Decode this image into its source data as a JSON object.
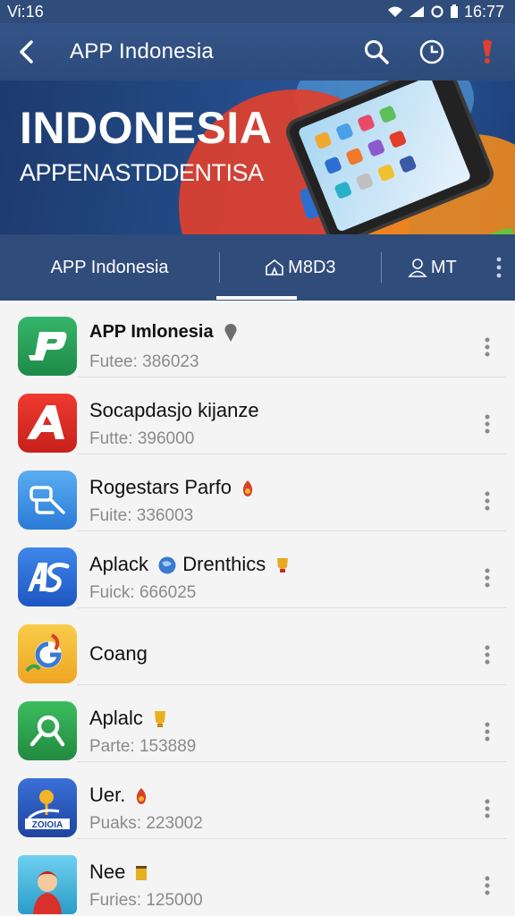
{
  "status_bar": {
    "left_text": "Vi:16",
    "time": "16:77"
  },
  "app_bar": {
    "title": "APP Indonesia"
  },
  "banner": {
    "title": "INDONESIA",
    "subtitle": "APPENASTDDENTISA"
  },
  "tabs": [
    {
      "label": "APP Indonesia",
      "icon": "none"
    },
    {
      "label": "M8D3",
      "icon": "home-icon"
    },
    {
      "label": "MT",
      "icon": "person-icon"
    }
  ],
  "colors": {
    "primary": "#2f4c7a",
    "accent_red": "#e0402e",
    "background": "#f4f4f4"
  },
  "apps": [
    {
      "name": "APP Imlonesia",
      "sub": "Futee: 386023",
      "icon": "green-p-app-icon",
      "color": "#2aa05a",
      "badge": "pin-icon"
    },
    {
      "name": "Socapdasjo kijanze",
      "sub": "Futte: 396000",
      "icon": "red-a-app-icon",
      "color": "#e0302a",
      "badge": ""
    },
    {
      "name": "Rogestars Parfo",
      "sub": "Fuite: 336003",
      "icon": "blue-link-app-icon",
      "color": "#3a8ee6",
      "badge": "flame-icon"
    },
    {
      "name": "Aplack",
      "name2": "Drenthics",
      "sub": "Fuick: 666025",
      "icon": "blue-as-app-icon",
      "color": "#2e6fd6",
      "badge": "globe-icon"
    },
    {
      "name": "Coang",
      "sub": "",
      "icon": "yellow-g-app-icon",
      "color": "#f3b52a",
      "badge": ""
    },
    {
      "name": "Aplalc",
      "sub": "Parte: 153889",
      "icon": "green-search-app-icon",
      "color": "#2fa84f",
      "badge": "trophy-icon"
    },
    {
      "name": "Uer.",
      "sub": "Puaks: 223002",
      "icon": "blue-pin-app-icon",
      "color": "#2b5cc4",
      "badge": "flame-icon"
    },
    {
      "name": "Nee",
      "sub": "Furies: 125000",
      "icon": "character-app-icon",
      "color": "#5bc0e8",
      "badge": "cup-icon"
    }
  ]
}
